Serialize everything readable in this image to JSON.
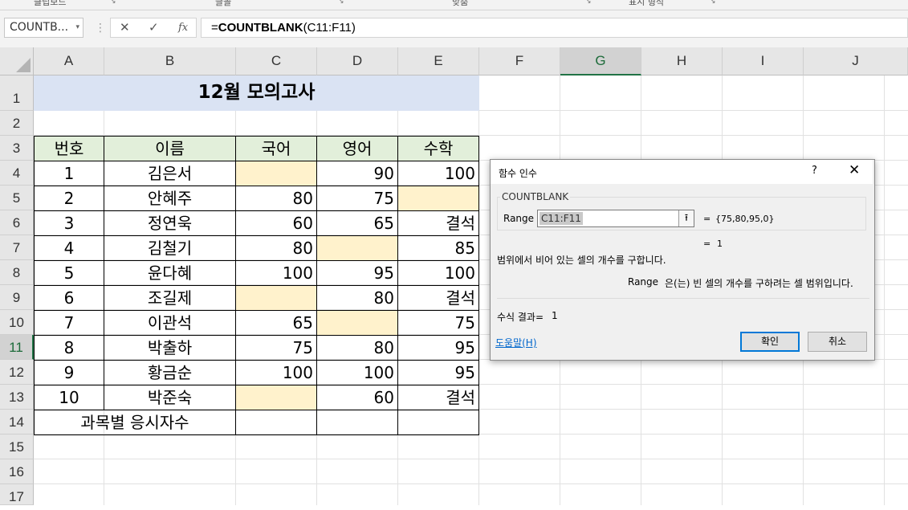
{
  "ribbon": {
    "groups": [
      {
        "label": "클립보드"
      },
      {
        "label": "글꼴"
      },
      {
        "label": "맞춤"
      },
      {
        "label": "표시 형식"
      }
    ],
    "launcher_icon": "↘"
  },
  "formula_bar": {
    "name_box": "COUNTB...",
    "name_box_arrow": "▾",
    "separator": "⋮",
    "cancel_icon": "✕",
    "enter_icon": "✓",
    "fx_icon": "fx",
    "formula_prefix": "=",
    "formula_func": "COUNTBLANK",
    "formula_args": "(C11:F11)"
  },
  "columns": [
    "A",
    "B",
    "C",
    "D",
    "E",
    "F",
    "G",
    "H",
    "I",
    "J"
  ],
  "rows": [
    "1",
    "2",
    "3",
    "4",
    "5",
    "6",
    "7",
    "8",
    "9",
    "10",
    "11",
    "12",
    "13",
    "14",
    "15",
    "16",
    "17"
  ],
  "selected_column": "G",
  "selected_row": "11",
  "sheet": {
    "title": "12월 모의고사",
    "headers": [
      "번호",
      "이름",
      "국어",
      "영어",
      "수학"
    ],
    "records": [
      [
        "1",
        "김은서",
        "",
        "90",
        "100"
      ],
      [
        "2",
        "안혜주",
        "80",
        "75",
        ""
      ],
      [
        "3",
        "정연욱",
        "60",
        "65",
        "결석"
      ],
      [
        "4",
        "김철기",
        "80",
        "",
        "85"
      ],
      [
        "5",
        "윤다혜",
        "100",
        "95",
        "100"
      ],
      [
        "6",
        "조길제",
        "",
        "80",
        "결석"
      ],
      [
        "7",
        "이관석",
        "65",
        "",
        "75"
      ],
      [
        "8",
        "박출하",
        "75",
        "80",
        "95"
      ],
      [
        "9",
        "황금순",
        "100",
        "100",
        "95"
      ],
      [
        "10",
        "박준숙",
        "",
        "60",
        "결석"
      ]
    ],
    "summary_label": "과목별 응시자수"
  },
  "dialog": {
    "title": "함수 인수",
    "help_icon": "?",
    "close_icon": "✕",
    "function_name": "COUNTBLANK",
    "arg_label": "Range",
    "arg_value": "C11:F11",
    "collapse_icon": "⭱",
    "eq": "=",
    "arg_result": "{75,80,95,0}",
    "func_result": "1",
    "function_description": "범위에서 비어 있는 셀의 개수를 구합니다.",
    "arg_desc_name": "Range",
    "arg_description": "은(는) 빈 셀의 개수를 구하려는 셀 범위입니다.",
    "formula_result_label": "수식 결과=",
    "formula_result_value": "1",
    "help_link": "도움말(H)",
    "ok_label": "확인",
    "cancel_label": "취소"
  }
}
